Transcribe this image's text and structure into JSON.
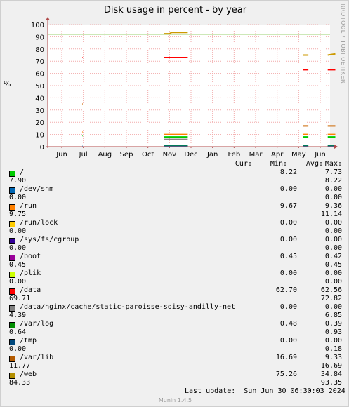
{
  "title": "Disk usage in percent - by year",
  "ylabel": "%",
  "side_label": "RRDTOOL / TOBI OETIKER",
  "columns": {
    "cur": "Cur:",
    "min": "Min:",
    "avg": "Avg:",
    "max": "Max:"
  },
  "chart_data": {
    "type": "line",
    "title": "Disk usage in percent - by year",
    "ylabel": "%",
    "ylim": [
      0,
      100
    ],
    "yticks": [
      0,
      10,
      20,
      30,
      40,
      50,
      60,
      70,
      80,
      90,
      100
    ],
    "xticks": [
      "Jun",
      "Jul",
      "Aug",
      "Sep",
      "Oct",
      "Nov",
      "Dec",
      "Jan",
      "Feb",
      "Mar",
      "Apr",
      "May",
      "Jun"
    ],
    "grid": true,
    "warning_line": 92,
    "series": [
      {
        "name": "/data",
        "color": "#ff0000",
        "segments": [
          {
            "x": [
              0.95,
              0.97
            ],
            "y": [
              73,
              73
            ]
          },
          {
            "x": [
              4.75,
              5.85
            ],
            "y": [
              73,
              73
            ]
          },
          {
            "x": [
              11.2,
              11.45
            ],
            "y": [
              63,
              63
            ]
          },
          {
            "x": [
              12.35,
              12.7
            ],
            "y": [
              63,
              63
            ]
          }
        ]
      },
      {
        "name": "/web",
        "color": "#cc9900",
        "segments": [
          {
            "x": [
              4.75,
              5.0,
              5.1,
              5.85
            ],
            "y": [
              92.5,
              92.5,
              93.5,
              93.5
            ]
          },
          {
            "x": [
              11.2,
              11.45
            ],
            "y": [
              75,
              75
            ]
          },
          {
            "x": [
              12.35,
              12.7
            ],
            "y": [
              75,
              76
            ]
          }
        ]
      },
      {
        "name": "/var/lib",
        "color": "#cc6600",
        "segments": [
          {
            "x": [
              0.95,
              0.97
            ],
            "y": [
              35,
              35
            ]
          },
          {
            "x": [
              11.2,
              11.45
            ],
            "y": [
              17,
              17
            ]
          },
          {
            "x": [
              12.35,
              12.7
            ],
            "y": [
              17,
              17
            ]
          }
        ]
      },
      {
        "name": "/run",
        "color": "#ff8000",
        "segments": [
          {
            "x": [
              0.95,
              0.97
            ],
            "y": [
              12,
              12
            ]
          },
          {
            "x": [
              4.75,
              5.85
            ],
            "y": [
              10,
              10
            ]
          },
          {
            "x": [
              11.2,
              11.45
            ],
            "y": [
              10,
              10
            ]
          },
          {
            "x": [
              12.35,
              12.7
            ],
            "y": [
              10,
              10
            ]
          }
        ]
      },
      {
        "name": "/",
        "color": "#00cc00",
        "segments": [
          {
            "x": [
              0.95,
              0.97
            ],
            "y": [
              9,
              9
            ]
          },
          {
            "x": [
              4.75,
              5.85
            ],
            "y": [
              8,
              8
            ]
          },
          {
            "x": [
              11.2,
              11.45
            ],
            "y": [
              8,
              8
            ]
          },
          {
            "x": [
              12.35,
              12.7
            ],
            "y": [
              8,
              8
            ]
          }
        ]
      },
      {
        "name": "/data/nginx/cache/static-paroisse-soisy-andilly-net",
        "color": "#888888",
        "segments": [
          {
            "x": [
              4.75,
              5.85
            ],
            "y": [
              6,
              6
            ]
          }
        ]
      },
      {
        "name": "/var/log",
        "color": "#008f00",
        "segments": [
          {
            "x": [
              4.75,
              5.85
            ],
            "y": [
              0.8,
              0.8
            ]
          },
          {
            "x": [
              11.2,
              11.45
            ],
            "y": [
              0.6,
              0.6
            ]
          },
          {
            "x": [
              12.35,
              12.7
            ],
            "y": [
              0.6,
              0.6
            ]
          }
        ]
      },
      {
        "name": "/dev/shm",
        "color": "#0066b3",
        "segments": [
          {
            "x": [
              0.95,
              0.97
            ],
            "y": [
              0.3,
              0.3
            ]
          },
          {
            "x": [
              4.75,
              5.85
            ],
            "y": [
              0.3,
              0.3
            ]
          },
          {
            "x": [
              11.2,
              11.45
            ],
            "y": [
              0.3,
              0.3
            ]
          },
          {
            "x": [
              12.35,
              12.7
            ],
            "y": [
              0.3,
              0.3
            ]
          }
        ]
      }
    ]
  },
  "legend": [
    {
      "name": "/",
      "color": "#00cc00",
      "cur": "7.90",
      "min": "8.22",
      "avg": "7.73",
      "max": "8.22"
    },
    {
      "name": "/dev/shm",
      "color": "#0066b3",
      "cur": "0.00",
      "min": "0.00",
      "avg": "0.00",
      "max": "0.00"
    },
    {
      "name": "/run",
      "color": "#ff8000",
      "cur": "9.75",
      "min": "9.67",
      "avg": "9.36",
      "max": "11.14"
    },
    {
      "name": "/run/lock",
      "color": "#ffcc00",
      "cur": "0.00",
      "min": "0.00",
      "avg": "0.00",
      "max": "0.00"
    },
    {
      "name": "/sys/fs/cgroup",
      "color": "#330099",
      "cur": "0.00",
      "min": "0.00",
      "avg": "0.00",
      "max": "0.00"
    },
    {
      "name": "/boot",
      "color": "#990099",
      "cur": "0.45",
      "min": "0.45",
      "avg": "0.42",
      "max": "0.45"
    },
    {
      "name": "/plik",
      "color": "#ccff00",
      "cur": "0.00",
      "min": "0.00",
      "avg": "0.00",
      "max": "0.00"
    },
    {
      "name": "/data",
      "color": "#ff0000",
      "cur": "69.71",
      "min": "62.70",
      "avg": "62.56",
      "max": "72.82"
    },
    {
      "name": "/data/nginx/cache/static-paroisse-soisy-andilly-net",
      "color": "#808080",
      "cur": "4.39",
      "min": "0.00",
      "avg": "0.00",
      "max": "6.85"
    },
    {
      "name": "/var/log",
      "color": "#008f00",
      "cur": "0.64",
      "min": "0.48",
      "avg": "0.39",
      "max": "0.93"
    },
    {
      "name": "/tmp",
      "color": "#00487d",
      "cur": "0.00",
      "min": "0.00",
      "avg": "0.00",
      "max": "0.18"
    },
    {
      "name": "/var/lib",
      "color": "#b35a00",
      "cur": "11.77",
      "min": "16.69",
      "avg": "9.33",
      "max": "16.69"
    },
    {
      "name": "/web",
      "color": "#b38f00",
      "cur": "84.33",
      "min": "75.26",
      "avg": "34.84",
      "max": "93.35"
    }
  ],
  "last_update": "Last update:  Sun Jun 30 06:30:03 2024",
  "footer": "Munin 1.4.5"
}
